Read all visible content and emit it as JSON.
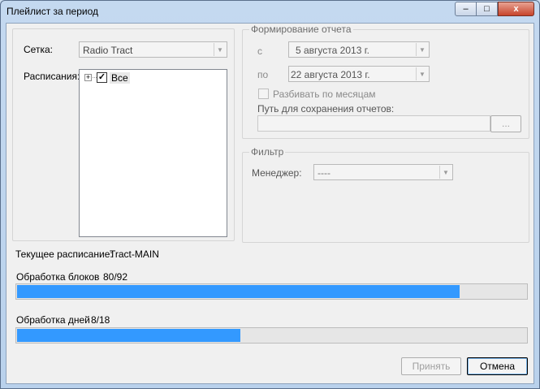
{
  "window": {
    "title": "Плейлист за период",
    "controls": {
      "minimize": "–",
      "maximize": "□",
      "close": "x"
    }
  },
  "left": {
    "grid_label": "Сетка:",
    "grid_value": "Radio Tract",
    "schedules_label": "Расписания:",
    "tree": {
      "expand": "+",
      "checked": true,
      "item": "Все"
    }
  },
  "report": {
    "group_title": "Формирование отчета",
    "from_label": "с",
    "from_date": "5  августа  2013 г.",
    "to_label": "по",
    "to_date": "22  августа  2013 г.",
    "split_label": "Разбивать по месяцам",
    "path_label": "Путь для сохранения отчетов:",
    "path_value": "",
    "browse_label": "..."
  },
  "filter": {
    "group_title": "Фильтр",
    "manager_label": "Менеджер:",
    "manager_value": "----"
  },
  "status": {
    "current_label": "Текущее расписание:",
    "current_value": "Tract-MAIN",
    "blocks_label": "Обработка блоков",
    "blocks_count": "80/92",
    "blocks_progress": 0.87,
    "days_label": "Обработка дней",
    "days_count": "8/18",
    "days_progress": 0.44
  },
  "buttons": {
    "accept": "Принять",
    "cancel": "Отмена"
  },
  "colors": {
    "progress_fill": "#3399ff",
    "title_bar": "#c4d9f0"
  }
}
